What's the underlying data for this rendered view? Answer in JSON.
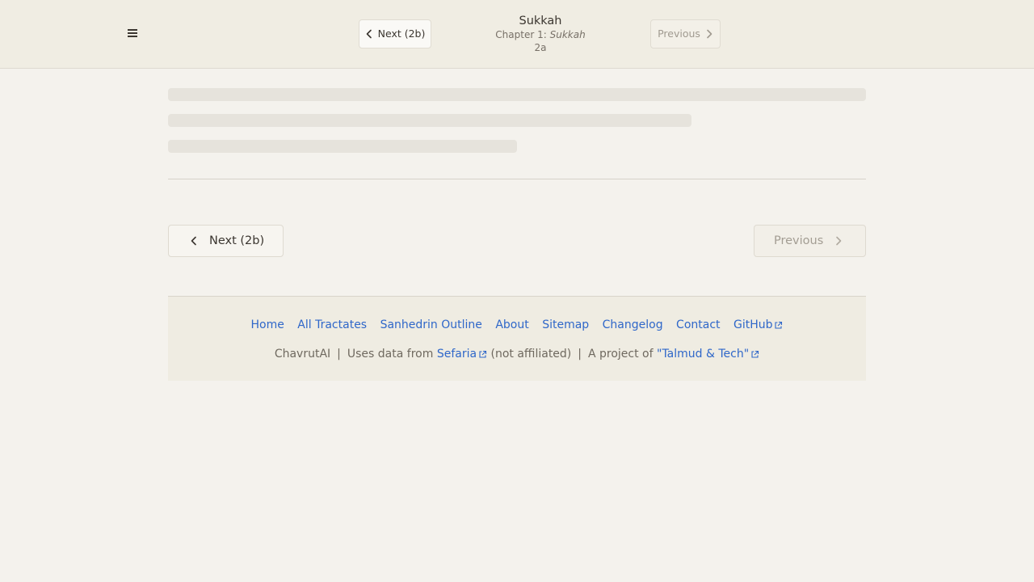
{
  "header": {
    "menu_icon": "hamburger-menu-icon",
    "next_label": "Next (2b)",
    "prev_label": "Previous",
    "title": "Sukkah",
    "chapter_prefix": "Chapter 1: ",
    "chapter_name": "Sukkah",
    "page": "2a"
  },
  "nav": {
    "next_label": "Next (2b)",
    "prev_label": "Previous"
  },
  "footer": {
    "links": [
      "Home",
      "All Tractates",
      "Sanhedrin Outline",
      "About",
      "Sitemap",
      "Changelog",
      "Contact",
      "GitHub"
    ],
    "brand": "ChavrutAI",
    "sep": "|",
    "uses_data_from": "Uses data from",
    "sefaria": "Sefaria",
    "not_affiliated": "(not affiliated)",
    "project_of": "A project of",
    "talmud_tech": "\"Talmud & Tech\""
  },
  "colors": {
    "background": "#f4f2ed",
    "header_bg": "#f0ede3",
    "link": "#2f67c9"
  }
}
